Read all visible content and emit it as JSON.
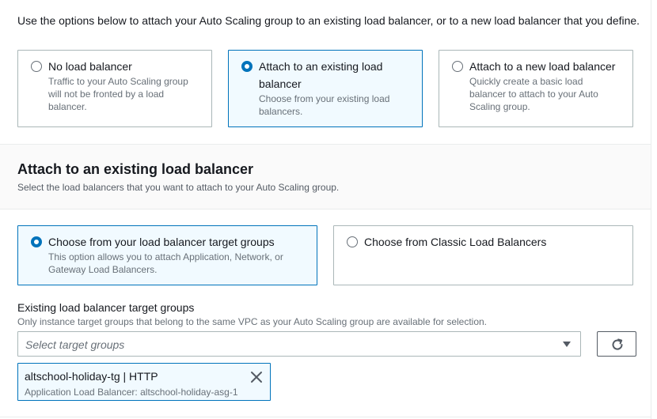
{
  "intro_text": "Use the options below to attach your Auto Scaling group to an existing load balancer, or to a new load balancer that you define.",
  "lb_options": [
    {
      "title": "No load balancer",
      "desc": "Traffic to your Auto Scaling group will not be fronted by a load balancer.",
      "selected": false
    },
    {
      "title": "Attach to an existing load balancer",
      "desc": "Choose from your existing load balancers.",
      "selected": true
    },
    {
      "title": "Attach to a new load balancer",
      "desc": "Quickly create a basic load balancer to attach to your Auto Scaling group.",
      "selected": false
    }
  ],
  "section": {
    "title": "Attach to an existing load balancer",
    "desc": "Select the load balancers that you want to attach to your Auto Scaling group."
  },
  "source_options": [
    {
      "title": "Choose from your load balancer target groups",
      "desc": "This option allows you to attach Application, Network, or Gateway Load Balancers.",
      "selected": true
    },
    {
      "title": "Choose from Classic Load Balancers",
      "desc": "",
      "selected": false
    }
  ],
  "target_groups": {
    "label": "Existing load balancer target groups",
    "hint": "Only instance target groups that belong to the same VPC as your Auto Scaling group are available for selection.",
    "placeholder": "Select target groups",
    "selected_tokens": [
      {
        "title": "altschool-holiday-tg | HTTP",
        "desc": "Application Load Balancer: altschool-holiday-asg-1"
      }
    ]
  },
  "icons": {
    "refresh": "refresh-icon",
    "dropdown": "caret-down-icon",
    "remove": "close-icon"
  },
  "colors": {
    "accent": "#0073bb",
    "selected_bg": "#f1faff",
    "border": "#aab7b8",
    "muted_text": "#687078"
  }
}
